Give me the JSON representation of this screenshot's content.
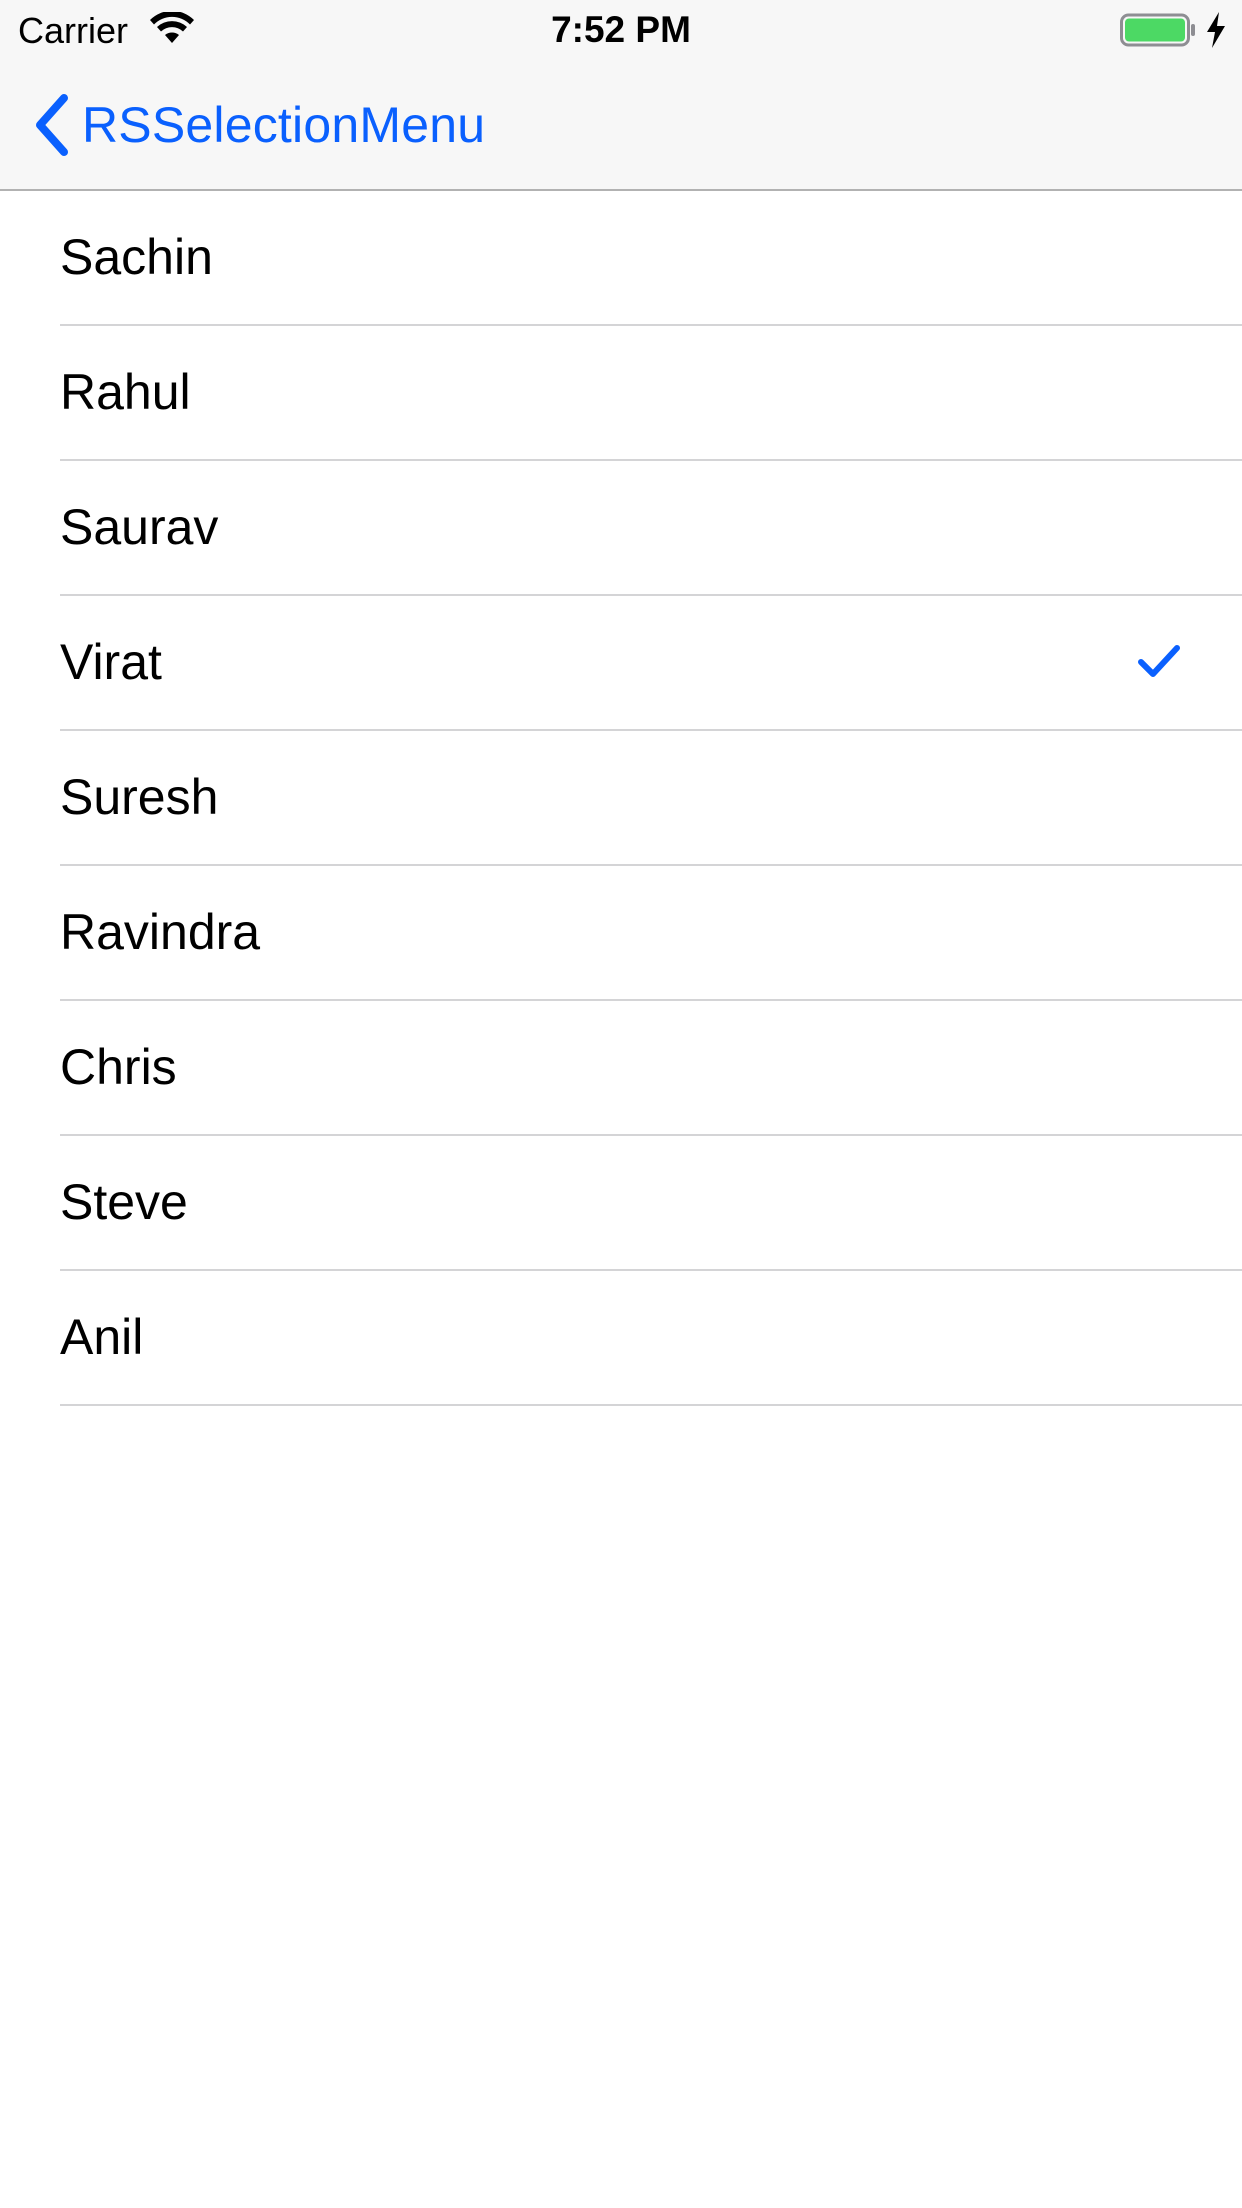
{
  "status_bar": {
    "carrier": "Carrier",
    "time": "7:52 PM",
    "icons": [
      "wifi-icon",
      "battery-icon",
      "charging-bolt-icon"
    ],
    "battery_color": "#4cd964"
  },
  "nav_bar": {
    "back_label": "RSSelectionMenu",
    "accent_color": "#0a60fe"
  },
  "list": {
    "items": [
      {
        "label": "Sachin",
        "selected": false
      },
      {
        "label": "Rahul",
        "selected": false
      },
      {
        "label": "Saurav",
        "selected": false
      },
      {
        "label": "Virat",
        "selected": true
      },
      {
        "label": "Suresh",
        "selected": false
      },
      {
        "label": "Ravindra",
        "selected": false
      },
      {
        "label": "Chris",
        "selected": false
      },
      {
        "label": "Steve",
        "selected": false
      },
      {
        "label": "Anil",
        "selected": false
      }
    ],
    "checkmark_icon": "checkmark-icon"
  }
}
